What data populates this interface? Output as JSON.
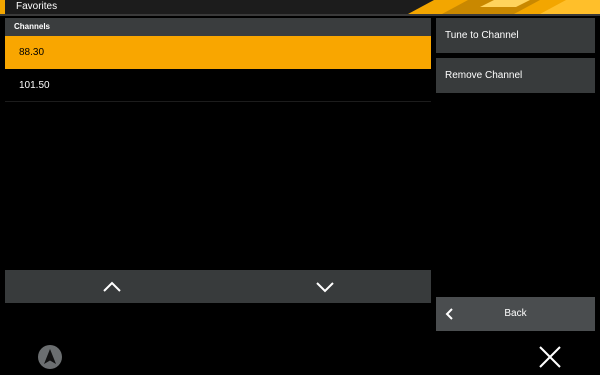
{
  "header": {
    "title": "Favorites",
    "accent_color": "#f3a600"
  },
  "channels": {
    "header": "Channels",
    "items": [
      {
        "label": "88.30",
        "selected": true
      },
      {
        "label": "101.50",
        "selected": false
      }
    ]
  },
  "actions": {
    "tune_label": "Tune to Channel",
    "remove_label": "Remove Channel"
  },
  "scroll": {
    "up_icon": "chevron-up-icon",
    "down_icon": "chevron-down-icon"
  },
  "back": {
    "label": "Back",
    "icon": "chevron-left-icon"
  },
  "footer": {
    "left_icon": "navigation-arrow-icon",
    "right_icon": "close-icon"
  },
  "colors": {
    "selected_bg": "#f9a600",
    "panel_bg": "#383b3c",
    "header_bg": "#3a3d3e",
    "background": "#000000"
  }
}
